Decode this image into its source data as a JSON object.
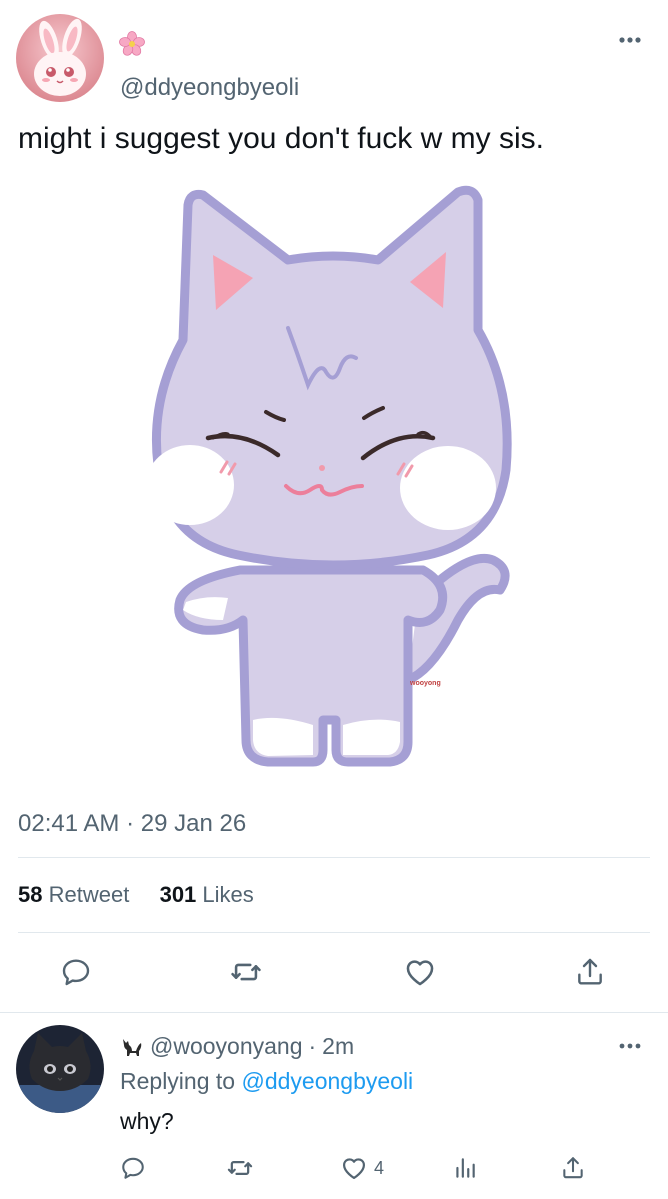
{
  "tweet": {
    "handle": "@ddyeongbyeoli",
    "text": "might i suggest you don't fuck w my sis.",
    "time": "02:41 AM",
    "date": "29 Jan 26",
    "retweets_count": "58",
    "retweets_label": "Retweet",
    "likes_count": "301",
    "likes_label": "Likes",
    "image_signature": "wooyong"
  },
  "reply": {
    "handle": "@wooyonyang",
    "age": "2m",
    "replying_prefix": "Replying to",
    "replying_to": "@ddyeongbyeoli",
    "text": "why?",
    "like_count": "4"
  },
  "icons": {
    "more": "more-horizontal-icon",
    "reply": "reply-icon",
    "retweet": "retweet-icon",
    "like": "heart-icon",
    "share": "share-icon",
    "analytics": "analytics-icon",
    "flower": "flower-icon",
    "cat": "cat-icon"
  },
  "colors": {
    "text": "#0f1419",
    "secondary": "#536471",
    "link": "#1d9bf0",
    "divider": "#e1e8ed",
    "cat_fill": "#d6cfe8",
    "cat_stroke": "#a59fd4"
  },
  "separator": "·"
}
